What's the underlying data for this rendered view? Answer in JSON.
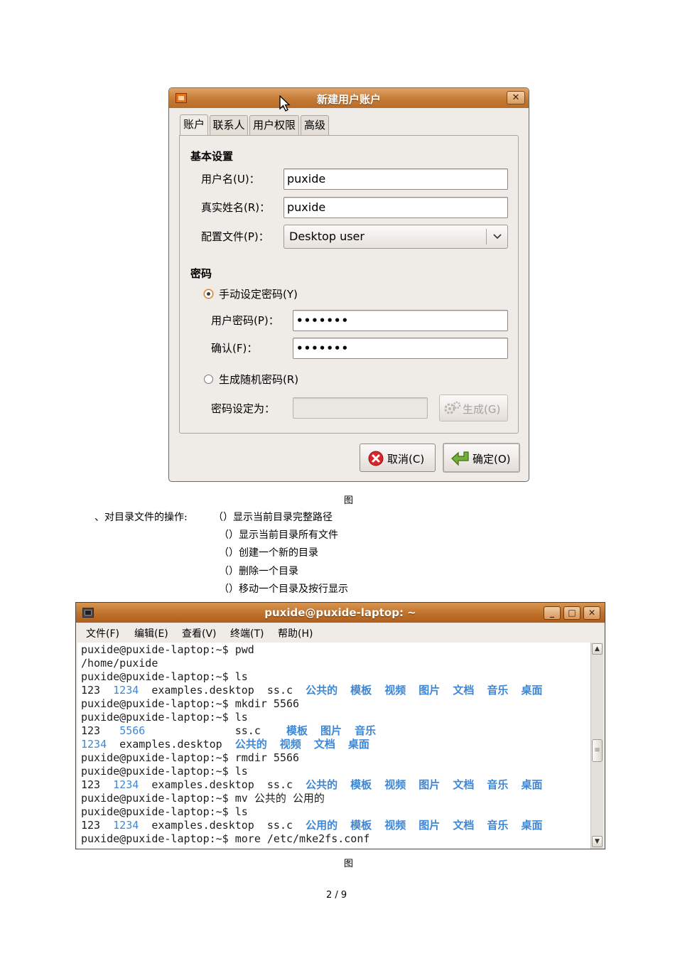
{
  "dialog": {
    "title": "新建用户账户",
    "close_glyph": "✕",
    "tabs": [
      "账户",
      "联系人",
      "用户权限",
      "高级"
    ],
    "basic_section": "基本设置",
    "username_label": "用户名(U)：",
    "username_value": "puxide",
    "realname_label": "真实姓名(R)：",
    "realname_value": "puxide",
    "profile_label": "配置文件(P)：",
    "profile_value": "Desktop user",
    "password_section": "密码",
    "manual_radio": "手动设定密码(Y)",
    "user_password_label": "用户密码(P)：",
    "user_password_value": "•••••••",
    "confirm_label": "确认(F)：",
    "confirm_value": "•••••••",
    "random_radio": "生成随机密码(R)",
    "password_set_label": "密码设定为：",
    "generate_button": "生成(G)",
    "cancel_button": "取消(C)",
    "ok_button": "确定(O)",
    "selected_tab": "账户",
    "selected_radio": "manual"
  },
  "caption1": "图",
  "ops": {
    "intro": "、对目录文件的操作:",
    "items": [
      "（）显示当前目录完整路径",
      "（）显示当前目录所有文件",
      "（）创建一个新的目录",
      "（）删除一个目录",
      "（）移动一个目录及按行显示"
    ]
  },
  "terminal": {
    "title": "puxide@puxide-laptop: ~",
    "window_buttons": [
      "_",
      "□",
      "✕"
    ],
    "menu": [
      "文件(F)",
      "编辑(E)",
      "查看(V)",
      "终端(T)",
      "帮助(H)"
    ],
    "lines": [
      [
        {
          "t": "puxide@puxide-laptop:~$ pwd",
          "c": ""
        }
      ],
      [
        {
          "t": "/home/puxide",
          "c": ""
        }
      ],
      [
        {
          "t": "puxide@puxide-laptop:~$ ls",
          "c": ""
        }
      ],
      [
        {
          "t": "123  ",
          "c": ""
        },
        {
          "t": "1234",
          "c": "blue"
        },
        {
          "t": "  examples.desktop  ss.c  ",
          "c": ""
        },
        {
          "t": "公共的  模板  视频  图片  文档  音乐  桌面",
          "c": "bluedir"
        }
      ],
      [
        {
          "t": "puxide@puxide-laptop:~$ mkdir 5566",
          "c": ""
        }
      ],
      [
        {
          "t": "puxide@puxide-laptop:~$ ls",
          "c": ""
        }
      ],
      [
        {
          "t": "123   ",
          "c": ""
        },
        {
          "t": "5566",
          "c": "blue"
        },
        {
          "t": "              ss.c    ",
          "c": ""
        },
        {
          "t": "模板  图片  音乐",
          "c": "bluedir"
        }
      ],
      [
        {
          "t": "1234",
          "c": "blue"
        },
        {
          "t": "  examples.desktop  ",
          "c": ""
        },
        {
          "t": "公共的  视频  文档  桌面",
          "c": "bluedir"
        }
      ],
      [
        {
          "t": "puxide@puxide-laptop:~$ rmdir 5566",
          "c": ""
        }
      ],
      [
        {
          "t": "puxide@puxide-laptop:~$ ls",
          "c": ""
        }
      ],
      [
        {
          "t": "123  ",
          "c": ""
        },
        {
          "t": "1234",
          "c": "blue"
        },
        {
          "t": "  examples.desktop  ss.c  ",
          "c": ""
        },
        {
          "t": "公共的  模板  视频  图片  文档  音乐  桌面",
          "c": "bluedir"
        }
      ],
      [
        {
          "t": "puxide@puxide-laptop:~$ mv 公共的 公用的",
          "c": ""
        }
      ],
      [
        {
          "t": "puxide@puxide-laptop:~$ ls",
          "c": ""
        }
      ],
      [
        {
          "t": "123  ",
          "c": ""
        },
        {
          "t": "1234",
          "c": "blue"
        },
        {
          "t": "  examples.desktop  ss.c  ",
          "c": ""
        },
        {
          "t": "公用的  模板  视频  图片  文档  音乐  桌面",
          "c": "bluedir"
        }
      ],
      [
        {
          "t": "puxide@puxide-laptop:~$ more /etc/mke2fs.conf",
          "c": ""
        }
      ]
    ]
  },
  "caption2": "图",
  "page_number": "2 / 9",
  "colors": {
    "titlebar": "#c57a35",
    "dir_blue": "#3f87d4",
    "dialog_bg": "#efebe7"
  }
}
